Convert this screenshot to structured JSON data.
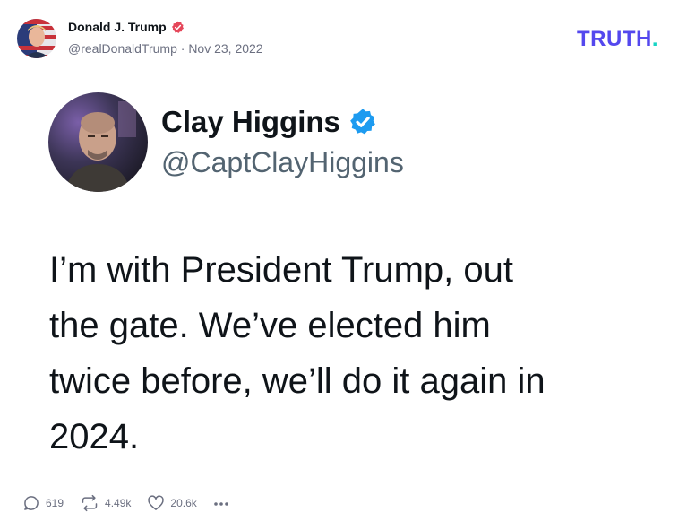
{
  "post": {
    "author_name": "Donald J. Trump",
    "author_handle": "@realDonaldTrump",
    "separator": " · ",
    "date": "Nov 23, 2022",
    "verified_color": "#e5475a"
  },
  "brand": {
    "logo_text": "TRUTH",
    "logo_dot": ".",
    "logo_color": "#5448ee",
    "dot_color": "#17d4c4"
  },
  "quoted_tweet": {
    "name": "Clay Higgins",
    "handle": "@CaptClayHiggins",
    "verified_color": "#1d9bf0",
    "body_lines": [
      "I’m with President Trump, out",
      "the gate. We’ve elected him",
      "twice before, we’ll do it again in",
      "2024."
    ]
  },
  "actions": {
    "replies": "619",
    "retruths": "4.49k",
    "likes": "20.6k",
    "more_icon": "more-horizontal-icon"
  }
}
